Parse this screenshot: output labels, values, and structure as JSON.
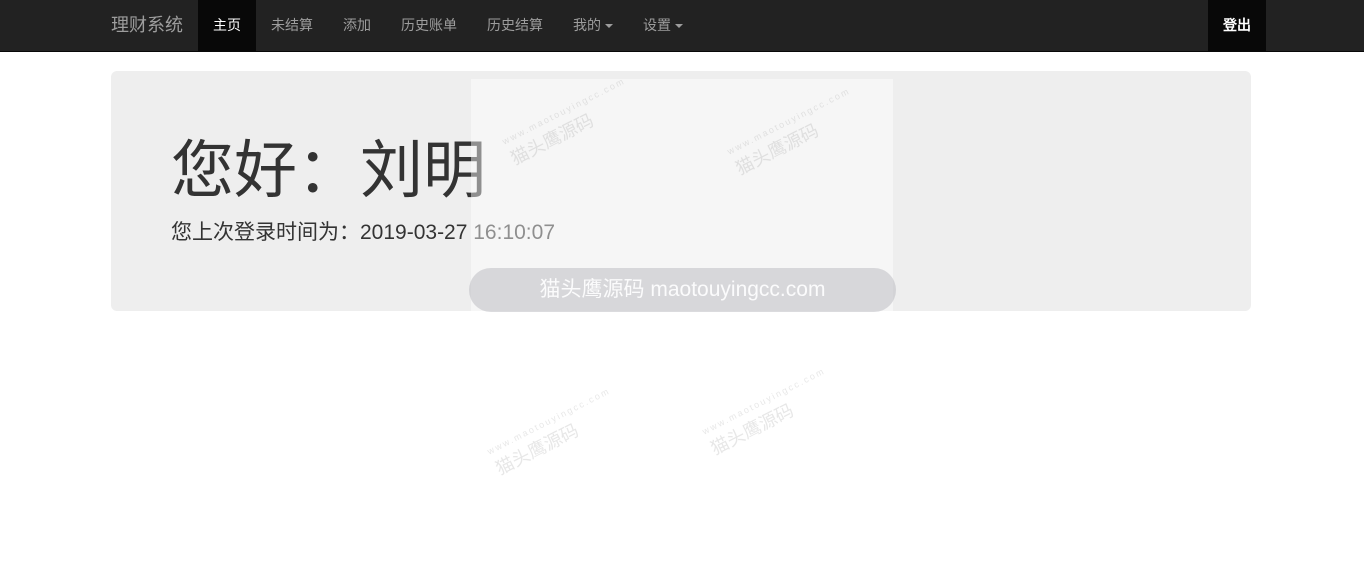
{
  "navbar": {
    "brand": "理财系统",
    "items": [
      {
        "label": "主页",
        "active": true
      },
      {
        "label": "未结算"
      },
      {
        "label": "添加"
      },
      {
        "label": "历史账单"
      },
      {
        "label": "历史结算"
      },
      {
        "label": "我的"
      },
      {
        "label": "设置"
      }
    ],
    "logout": "登出"
  },
  "jumbotron": {
    "greeting": "您好：刘明",
    "last_login": "您上次登录时间为：2019-03-27 16:10:07"
  },
  "watermark": {
    "text": "猫头鹰源码 maotouyingcc.com",
    "stamp_cn": "猫头鹰源码",
    "stamp_en": "www.maotouyingcc.com"
  },
  "colors": {
    "navbar_bg": "#222222",
    "active_bg": "#080808",
    "jumbotron_bg": "#eeeeee"
  }
}
